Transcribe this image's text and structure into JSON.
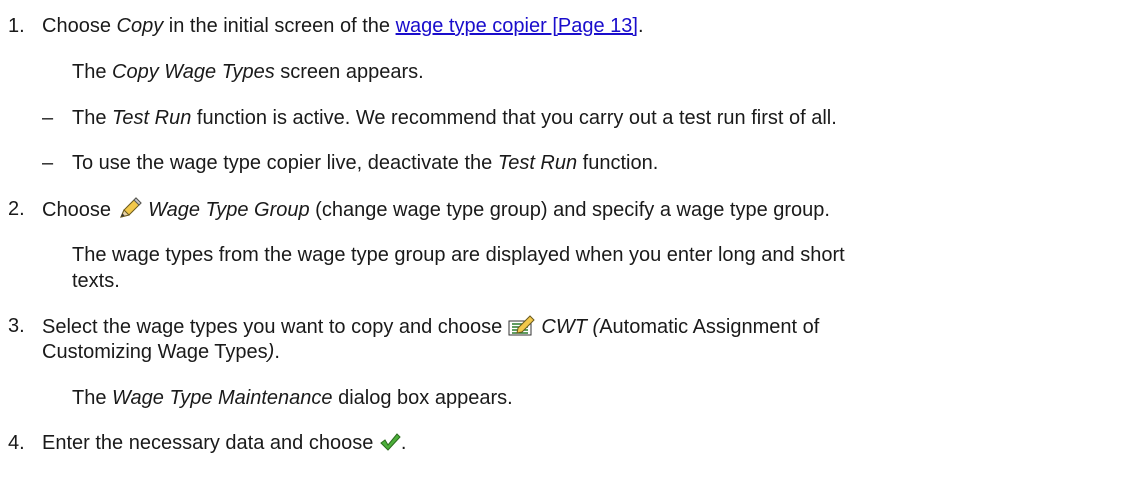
{
  "step1": {
    "number": "1.",
    "pre": "Choose ",
    "italic": "Copy",
    "mid": " in the initial screen of the ",
    "link": "wage type copier [Page 13]",
    "post": ".",
    "result_italic": "Copy Wage Types",
    "result_rest": " screen appears.",
    "bullets": [
      {
        "dash": "–",
        "pre": "The ",
        "italic": "Test Run",
        "post": " function is active. We recommend that you carry out a test run first of all."
      },
      {
        "dash": "–",
        "pre": "To use the wage type copier live, deactivate the ",
        "italic": "Test Run",
        "post": " function."
      }
    ]
  },
  "step2": {
    "number": "2.",
    "pre": "Choose ",
    "icon": "pencil-icon",
    "italic": "Wage Type Group",
    "post": " (change wage type group) and specify a wage type group.",
    "result_line1": "The wage types from the wage type group are displayed when you enter long and short",
    "result_line2": "texts."
  },
  "step3": {
    "number": "3.",
    "pre": "Select the wage types you want to copy and choose ",
    "icon": "cwt-icon",
    "italic": "CWT (",
    "mid": "Automatic Assignment of",
    "line2": "Customizing Wage Types",
    "line2_italic": ")",
    "line2_post": ".",
    "result_pre": "The ",
    "result_italic": "Wage Type Maintenance",
    "result_post": " dialog box appears."
  },
  "step4": {
    "number": "4.",
    "pre": "Enter the necessary data and choose ",
    "icon": "checkmark-icon",
    "post": "."
  }
}
